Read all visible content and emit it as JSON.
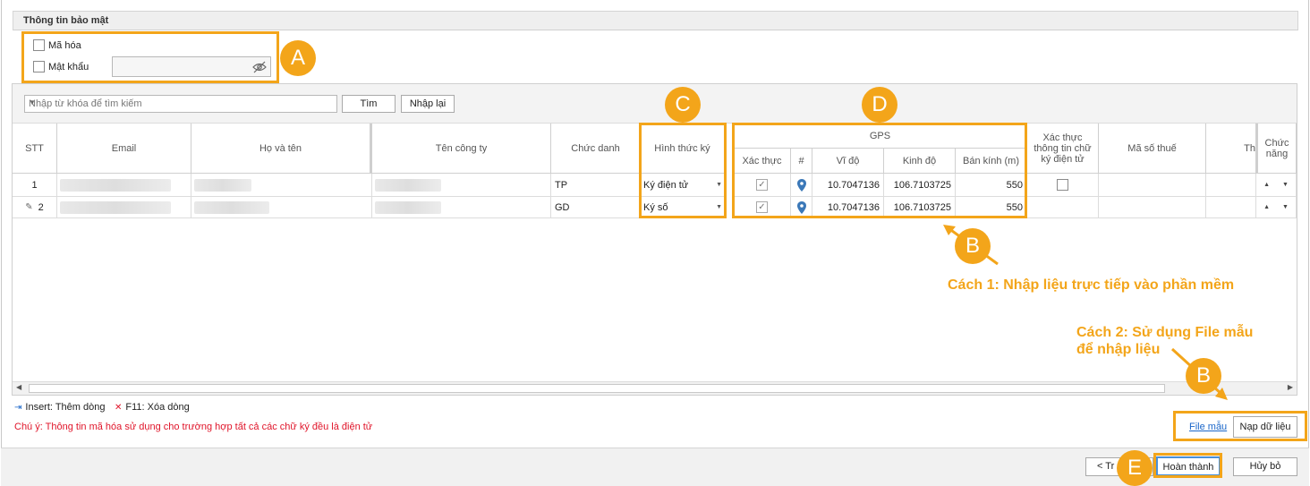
{
  "section": {
    "title": "Thông tin bảo mật"
  },
  "security": {
    "encrypt_label": "Mã hóa",
    "password_label": "Mật khẩu",
    "password_value": ""
  },
  "toolbar": {
    "search_placeholder": "Nhập từ khóa để tìm kiếm",
    "find_label": "Tìm",
    "reset_label": "Nhập lại"
  },
  "grid": {
    "headers": {
      "stt": "STT",
      "email": "Email",
      "name": "Họ và tên",
      "company": "Tên công ty",
      "title": "Chức danh",
      "sign_type": "Hình thức ký",
      "gps": "GPS",
      "verify": "Xác thực",
      "hash": "#",
      "lat": "Vĩ độ",
      "lng": "Kinh độ",
      "radius": "Bán kính (m)",
      "verify_info": "Xác thực thông tin chữ ký điện tử",
      "tax": "Mã số thuế",
      "extra": "Th",
      "func": "Chức năng"
    },
    "rows": [
      {
        "stt": "1",
        "title": "TP",
        "sign_type": "Ký điện tử",
        "lat": "10.7047136",
        "lng": "106.7103725",
        "radius": "550"
      },
      {
        "stt": "2",
        "title": "GD",
        "sign_type": "Ký số",
        "lat": "10.7047136",
        "lng": "106.7103725",
        "radius": "550"
      }
    ]
  },
  "footer": {
    "insert_hint": "Insert: Thêm dòng",
    "delete_hint": "F11: Xóa dòng",
    "note": "Chú ý: Thông tin mã hóa sử dụng cho trường hợp tất cả các chữ ký đều là điện tử",
    "file_sample": "File mẫu",
    "load_data": "Nạp dữ liệu"
  },
  "nav": {
    "back": "< Tr",
    "finish": "Hoàn thành",
    "cancel": "Hủy bỏ"
  },
  "annotations": {
    "a": "A",
    "b": "B",
    "c": "C",
    "d": "D",
    "e": "E",
    "way1": "Cách 1: Nhập liệu trực tiếp vào phần mềm",
    "way2_line1": "Cách 2: Sử dụng File mẫu",
    "way2_line2": "để nhập liệu"
  },
  "colors": {
    "accent": "#f3a51a",
    "note_red": "#e0152a",
    "link_blue": "#1a66c9",
    "pin_blue": "#3b78b8"
  }
}
